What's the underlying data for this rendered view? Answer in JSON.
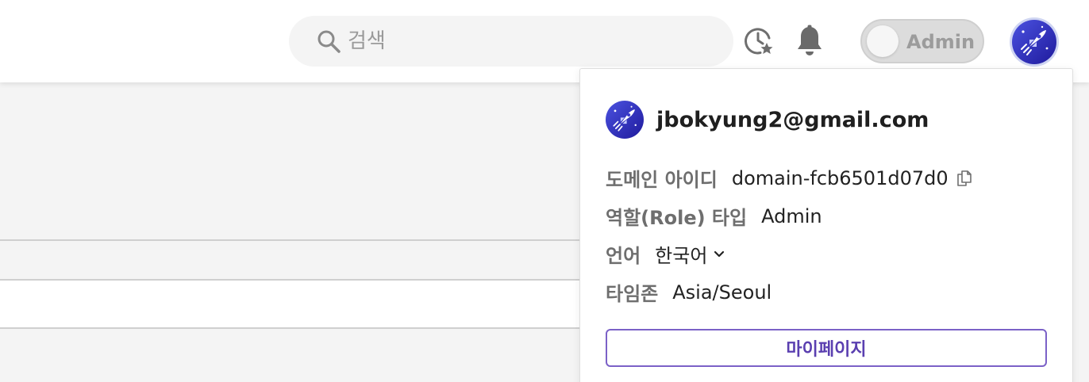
{
  "header": {
    "search": {
      "placeholder": "검색",
      "value": ""
    },
    "history_icon": "clock-star-icon",
    "notification_icon": "bell-icon",
    "role_toggle": {
      "label": "Admin",
      "state": "off"
    },
    "avatar_icon": "rocket-avatar"
  },
  "profile_menu": {
    "email": "jbokyung2@gmail.com",
    "fields": {
      "domain_id": {
        "label": "도메인 아이디",
        "value": "domain-fcb6501d07d0",
        "action_icon": "copy-icon"
      },
      "role_type": {
        "label": "역할(Role) 타입",
        "value": "Admin"
      },
      "language": {
        "label": "언어",
        "value": "한국어"
      },
      "timezone": {
        "label": "타임존",
        "value": "Asia/Seoul"
      }
    },
    "mypage_button": "마이페이지"
  },
  "colors": {
    "accent": "#7b61c7",
    "accent_text": "#5a3fb0",
    "avatar_bg": "#2f2fb8",
    "page_bg": "#f4f4f4"
  }
}
